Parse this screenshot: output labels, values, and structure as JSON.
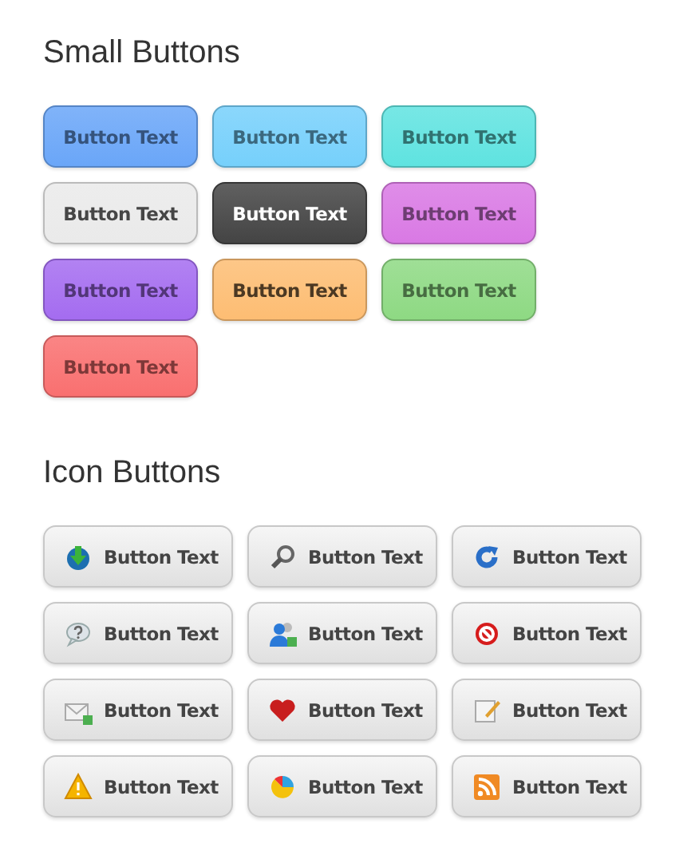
{
  "sections": [
    {
      "title": "Small Buttons",
      "kind": "color",
      "buttons": [
        {
          "label": "Button Text",
          "color": "#6aa6f8"
        },
        {
          "label": "Button Text",
          "color": "#76d0fb"
        },
        {
          "label": "Button Text",
          "color": "#5fe3e0"
        },
        {
          "label": "Button Text",
          "color": "#eaeaea"
        },
        {
          "label": "Button Text",
          "color": "#444444"
        },
        {
          "label": "Button Text",
          "color": "#d979e4"
        },
        {
          "label": "Button Text",
          "color": "#a46cf0"
        },
        {
          "label": "Button Text",
          "color": "#fdbd73"
        },
        {
          "label": "Button Text",
          "color": "#8ed983"
        },
        {
          "label": "Button Text",
          "color": "#f97070"
        }
      ]
    },
    {
      "title": "Icon Buttons",
      "kind": "icon",
      "buttons": [
        {
          "label": "Button Text"
        },
        {
          "label": "Button Text"
        },
        {
          "label": "Button Text"
        },
        {
          "label": "Button Text"
        },
        {
          "label": "Button Text"
        },
        {
          "label": "Button Text"
        },
        {
          "label": "Button Text"
        },
        {
          "label": "Button Text"
        },
        {
          "label": "Button Text"
        },
        {
          "label": "Button Text"
        },
        {
          "label": "Button Text"
        },
        {
          "label": "Button Text"
        }
      ]
    }
  ]
}
